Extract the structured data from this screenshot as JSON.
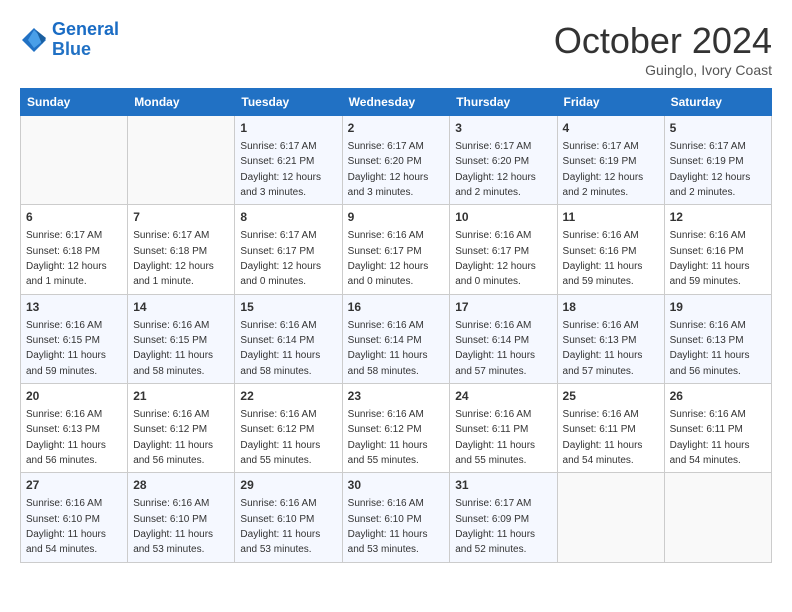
{
  "header": {
    "logo_general": "General",
    "logo_blue": "Blue",
    "month_title": "October 2024",
    "subtitle": "Guinglo, Ivory Coast"
  },
  "days_of_week": [
    "Sunday",
    "Monday",
    "Tuesday",
    "Wednesday",
    "Thursday",
    "Friday",
    "Saturday"
  ],
  "weeks": [
    [
      {
        "day": "",
        "info": ""
      },
      {
        "day": "",
        "info": ""
      },
      {
        "day": "1",
        "info": "Sunrise: 6:17 AM\nSunset: 6:21 PM\nDaylight: 12 hours and 3 minutes."
      },
      {
        "day": "2",
        "info": "Sunrise: 6:17 AM\nSunset: 6:20 PM\nDaylight: 12 hours and 3 minutes."
      },
      {
        "day": "3",
        "info": "Sunrise: 6:17 AM\nSunset: 6:20 PM\nDaylight: 12 hours and 2 minutes."
      },
      {
        "day": "4",
        "info": "Sunrise: 6:17 AM\nSunset: 6:19 PM\nDaylight: 12 hours and 2 minutes."
      },
      {
        "day": "5",
        "info": "Sunrise: 6:17 AM\nSunset: 6:19 PM\nDaylight: 12 hours and 2 minutes."
      }
    ],
    [
      {
        "day": "6",
        "info": "Sunrise: 6:17 AM\nSunset: 6:18 PM\nDaylight: 12 hours and 1 minute."
      },
      {
        "day": "7",
        "info": "Sunrise: 6:17 AM\nSunset: 6:18 PM\nDaylight: 12 hours and 1 minute."
      },
      {
        "day": "8",
        "info": "Sunrise: 6:17 AM\nSunset: 6:17 PM\nDaylight: 12 hours and 0 minutes."
      },
      {
        "day": "9",
        "info": "Sunrise: 6:16 AM\nSunset: 6:17 PM\nDaylight: 12 hours and 0 minutes."
      },
      {
        "day": "10",
        "info": "Sunrise: 6:16 AM\nSunset: 6:17 PM\nDaylight: 12 hours and 0 minutes."
      },
      {
        "day": "11",
        "info": "Sunrise: 6:16 AM\nSunset: 6:16 PM\nDaylight: 11 hours and 59 minutes."
      },
      {
        "day": "12",
        "info": "Sunrise: 6:16 AM\nSunset: 6:16 PM\nDaylight: 11 hours and 59 minutes."
      }
    ],
    [
      {
        "day": "13",
        "info": "Sunrise: 6:16 AM\nSunset: 6:15 PM\nDaylight: 11 hours and 59 minutes."
      },
      {
        "day": "14",
        "info": "Sunrise: 6:16 AM\nSunset: 6:15 PM\nDaylight: 11 hours and 58 minutes."
      },
      {
        "day": "15",
        "info": "Sunrise: 6:16 AM\nSunset: 6:14 PM\nDaylight: 11 hours and 58 minutes."
      },
      {
        "day": "16",
        "info": "Sunrise: 6:16 AM\nSunset: 6:14 PM\nDaylight: 11 hours and 58 minutes."
      },
      {
        "day": "17",
        "info": "Sunrise: 6:16 AM\nSunset: 6:14 PM\nDaylight: 11 hours and 57 minutes."
      },
      {
        "day": "18",
        "info": "Sunrise: 6:16 AM\nSunset: 6:13 PM\nDaylight: 11 hours and 57 minutes."
      },
      {
        "day": "19",
        "info": "Sunrise: 6:16 AM\nSunset: 6:13 PM\nDaylight: 11 hours and 56 minutes."
      }
    ],
    [
      {
        "day": "20",
        "info": "Sunrise: 6:16 AM\nSunset: 6:13 PM\nDaylight: 11 hours and 56 minutes."
      },
      {
        "day": "21",
        "info": "Sunrise: 6:16 AM\nSunset: 6:12 PM\nDaylight: 11 hours and 56 minutes."
      },
      {
        "day": "22",
        "info": "Sunrise: 6:16 AM\nSunset: 6:12 PM\nDaylight: 11 hours and 55 minutes."
      },
      {
        "day": "23",
        "info": "Sunrise: 6:16 AM\nSunset: 6:12 PM\nDaylight: 11 hours and 55 minutes."
      },
      {
        "day": "24",
        "info": "Sunrise: 6:16 AM\nSunset: 6:11 PM\nDaylight: 11 hours and 55 minutes."
      },
      {
        "day": "25",
        "info": "Sunrise: 6:16 AM\nSunset: 6:11 PM\nDaylight: 11 hours and 54 minutes."
      },
      {
        "day": "26",
        "info": "Sunrise: 6:16 AM\nSunset: 6:11 PM\nDaylight: 11 hours and 54 minutes."
      }
    ],
    [
      {
        "day": "27",
        "info": "Sunrise: 6:16 AM\nSunset: 6:10 PM\nDaylight: 11 hours and 54 minutes."
      },
      {
        "day": "28",
        "info": "Sunrise: 6:16 AM\nSunset: 6:10 PM\nDaylight: 11 hours and 53 minutes."
      },
      {
        "day": "29",
        "info": "Sunrise: 6:16 AM\nSunset: 6:10 PM\nDaylight: 11 hours and 53 minutes."
      },
      {
        "day": "30",
        "info": "Sunrise: 6:16 AM\nSunset: 6:10 PM\nDaylight: 11 hours and 53 minutes."
      },
      {
        "day": "31",
        "info": "Sunrise: 6:17 AM\nSunset: 6:09 PM\nDaylight: 11 hours and 52 minutes."
      },
      {
        "day": "",
        "info": ""
      },
      {
        "day": "",
        "info": ""
      }
    ]
  ]
}
